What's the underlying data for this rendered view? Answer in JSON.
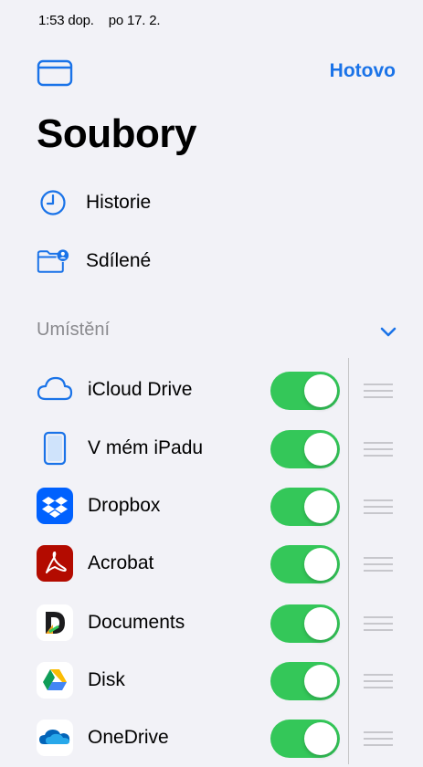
{
  "status_bar": {
    "time": "1:53 dop.",
    "date": "po 17. 2."
  },
  "header": {
    "done_label": "Hotovo",
    "title": "Soubory"
  },
  "nav": {
    "items": [
      {
        "label": "Historie",
        "icon": "clock-icon"
      },
      {
        "label": "Sdílené",
        "icon": "shared-folder-icon"
      }
    ]
  },
  "locations": {
    "header": "Umístění",
    "items": [
      {
        "label": "iCloud Drive",
        "icon": "icloud-icon",
        "enabled": true
      },
      {
        "label": "V mém iPadu",
        "icon": "ipad-icon",
        "enabled": true
      },
      {
        "label": "Dropbox",
        "icon": "dropbox-icon",
        "enabled": true
      },
      {
        "label": "Acrobat",
        "icon": "acrobat-icon",
        "enabled": true
      },
      {
        "label": "Documents",
        "icon": "documents-icon",
        "enabled": true
      },
      {
        "label": "Disk",
        "icon": "google-drive-icon",
        "enabled": true
      },
      {
        "label": "OneDrive",
        "icon": "onedrive-icon",
        "enabled": true
      }
    ]
  },
  "colors": {
    "accent": "#1a73e8",
    "toggle_on": "#34c759",
    "background": "#f2f2f7",
    "section_header": "#8a8a8e"
  }
}
